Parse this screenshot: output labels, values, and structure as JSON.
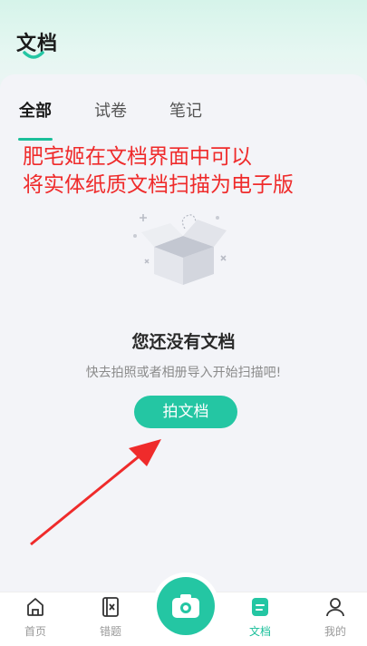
{
  "header": {
    "title": "文档"
  },
  "tabs": [
    {
      "label": "全部",
      "active": true
    },
    {
      "label": "试卷",
      "active": false
    },
    {
      "label": "笔记",
      "active": false
    }
  ],
  "annotation": {
    "line1": "肥宅姬在文档界面中可以",
    "line2": "将实体纸质文档扫描为电子版"
  },
  "empty_state": {
    "title": "您还没有文档",
    "subtitle": "快去拍照或者相册导入开始扫描吧!",
    "button_label": "拍文档"
  },
  "bottom_nav": [
    {
      "label": "首页",
      "icon": "home-icon",
      "active": false
    },
    {
      "label": "错题",
      "icon": "wrong-questions-icon",
      "active": false
    },
    {
      "label": "文档",
      "icon": "document-icon",
      "active": true
    },
    {
      "label": "我的",
      "icon": "profile-icon",
      "active": false
    }
  ],
  "colors": {
    "accent": "#24c6a3",
    "annotation_red": "#ef2b2b"
  }
}
